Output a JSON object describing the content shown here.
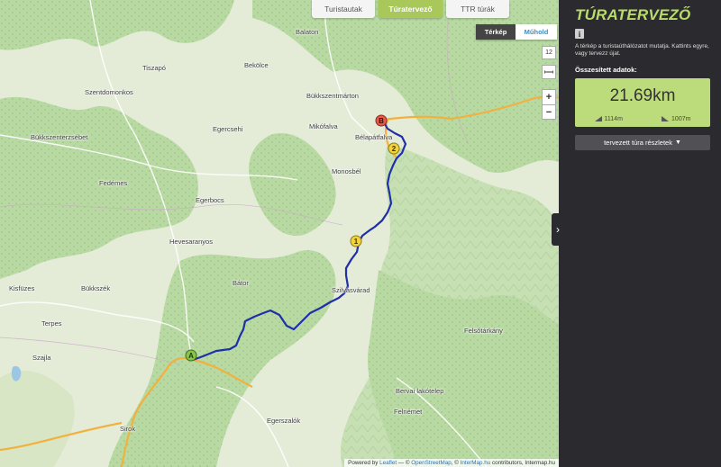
{
  "tabs": [
    {
      "label": "Turistautak",
      "active": false
    },
    {
      "label": "Túratervező",
      "active": true
    },
    {
      "label": "TTR túrák",
      "active": false
    }
  ],
  "map_type": {
    "map_label": "Térkép",
    "satellite_label": "Műhold",
    "selected": "Térkép"
  },
  "zoom_level": "12",
  "controls": {
    "zoom_in": "+",
    "zoom_out": "−",
    "measure_icon": "ruler-icon"
  },
  "places": [
    {
      "name": "Balaton"
    },
    {
      "name": "Tiszapó"
    },
    {
      "name": "Bekölce"
    },
    {
      "name": "Szentdomonkos"
    },
    {
      "name": "Bükkszentmárton"
    },
    {
      "name": "Bükkszenterzsébet"
    },
    {
      "name": "Egercsehi"
    },
    {
      "name": "Mikófalva"
    },
    {
      "name": "Bélapátfalva"
    },
    {
      "name": "Monosbél"
    },
    {
      "name": "Fedémes"
    },
    {
      "name": "Egerbocs"
    },
    {
      "name": "Hevesaranyos"
    },
    {
      "name": "Bátor"
    },
    {
      "name": "Kisfüzes"
    },
    {
      "name": "Bükkszék"
    },
    {
      "name": "Szilvásvárad"
    },
    {
      "name": "Terpes"
    },
    {
      "name": "Szajla"
    },
    {
      "name": "Felsőtárkány"
    },
    {
      "name": "Bervai lakótelep"
    },
    {
      "name": "Felnémet"
    },
    {
      "name": "Egerszalók"
    },
    {
      "name": "Sirok"
    }
  ],
  "route": {
    "color": "#1f2fa8",
    "start_label": "A",
    "end_label": "B",
    "waypoints": [
      "1",
      "2"
    ]
  },
  "attribution": {
    "prefix": "Powered by",
    "leaflet": "Leaflet",
    "mid": "— ©",
    "osm": "OpenStreetMap",
    "sep": ", ©",
    "intermap": "InterMap.hu",
    "suffix": "contributors, Intermap.hu"
  },
  "sidebar": {
    "title": "TÚRATERVEZŐ",
    "info_icon": "info-icon",
    "description": "A térkép a turistaúthálózatot mutatja. Kattints egyre, vagy tervezz újat.",
    "stats_label": "Összesített adatok:",
    "distance": "21.69km",
    "ascent": "1114m",
    "descent": "1007m",
    "details_button": "tervezett túra részletek"
  },
  "colors": {
    "accent": "#b8db6a",
    "stats_bg": "#bcdc7b",
    "tab_active": "#a8c85a",
    "sidebar_bg": "#2b2b2f"
  }
}
